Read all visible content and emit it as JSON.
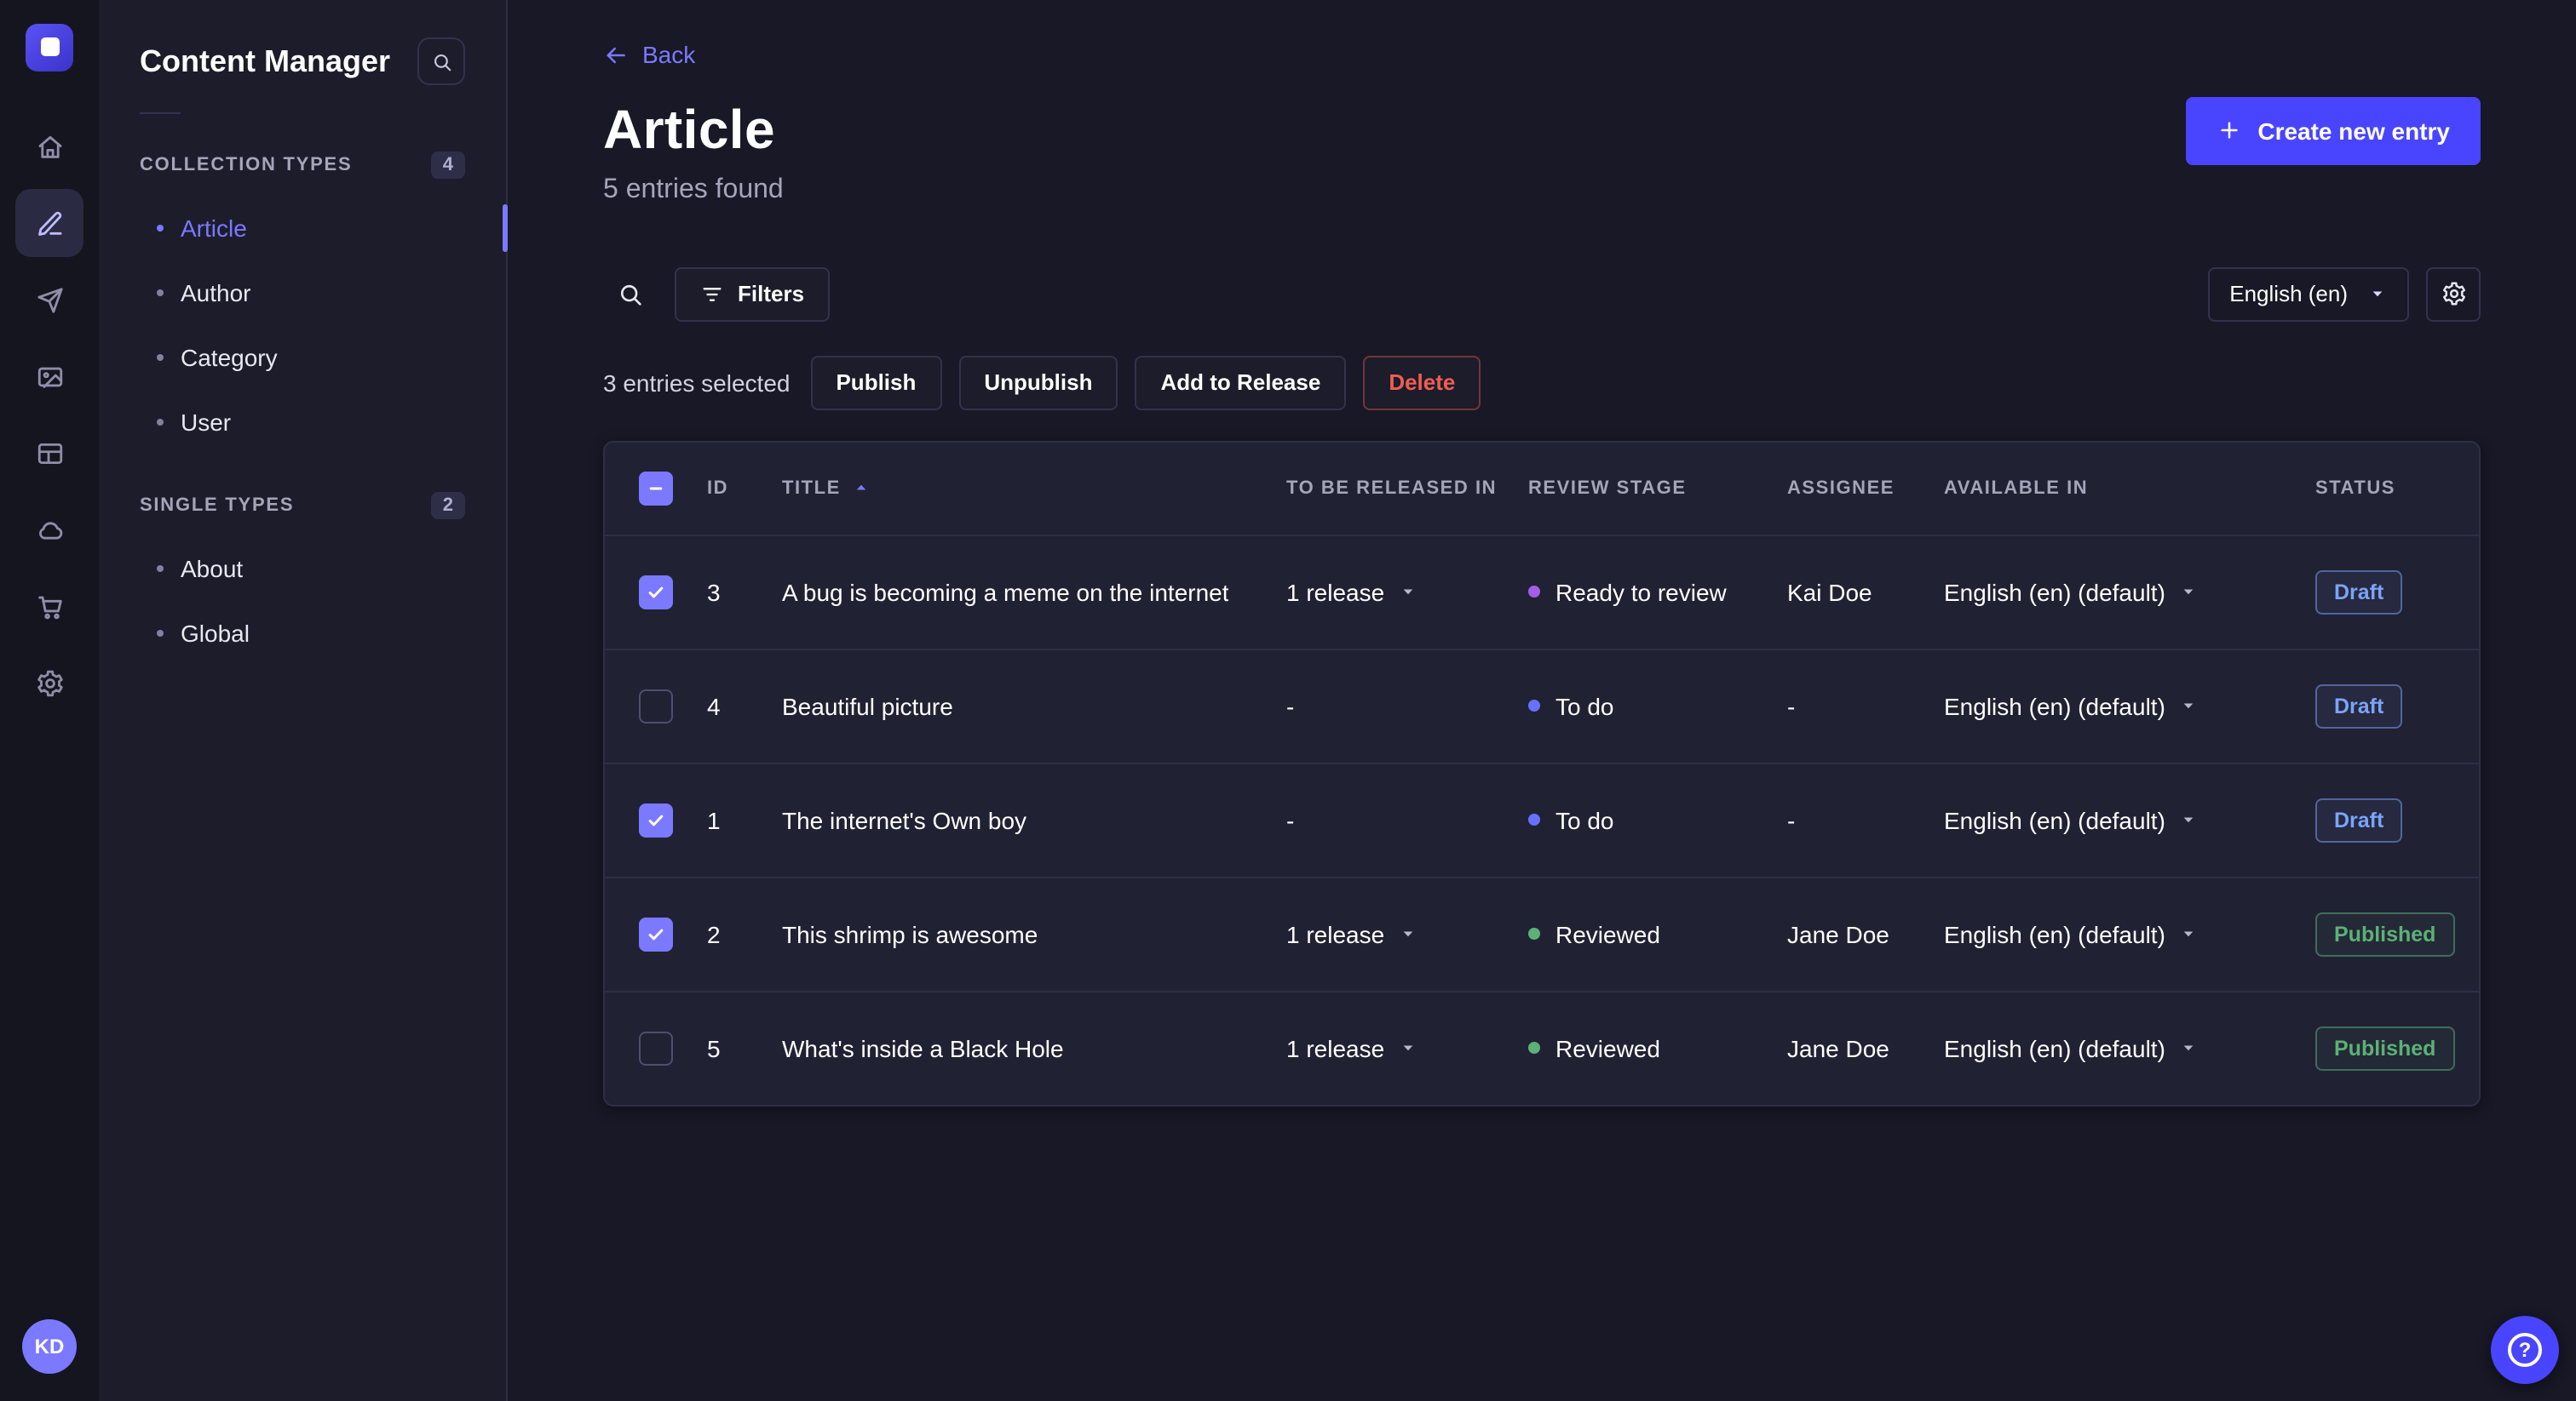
{
  "nav_rail": {
    "avatar_initials": "KD",
    "icons": [
      {
        "name": "home-icon",
        "active": false
      },
      {
        "name": "content-manager-icon",
        "active": true
      },
      {
        "name": "releases-icon",
        "active": false
      },
      {
        "name": "media-library-icon",
        "active": false
      },
      {
        "name": "content-type-builder-icon",
        "active": false
      },
      {
        "name": "cloud-icon",
        "active": false
      },
      {
        "name": "marketplace-icon",
        "active": false
      },
      {
        "name": "settings-icon",
        "active": false
      }
    ]
  },
  "sidebar": {
    "title": "Content Manager",
    "sections": [
      {
        "label": "COLLECTION TYPES",
        "badge": "4",
        "items": [
          {
            "label": "Article",
            "active": true
          },
          {
            "label": "Author",
            "active": false
          },
          {
            "label": "Category",
            "active": false
          },
          {
            "label": "User",
            "active": false
          }
        ]
      },
      {
        "label": "SINGLE TYPES",
        "badge": "2",
        "items": [
          {
            "label": "About",
            "active": false
          },
          {
            "label": "Global",
            "active": false
          }
        ]
      }
    ]
  },
  "header": {
    "back_label": "Back",
    "title": "Article",
    "subtitle": "5 entries found",
    "create_button": "Create new entry"
  },
  "toolbar": {
    "filters_label": "Filters",
    "locale_value": "English (en)"
  },
  "selection": {
    "text": "3 entries selected",
    "actions": [
      {
        "label": "Publish",
        "danger": false
      },
      {
        "label": "Unpublish",
        "danger": false
      },
      {
        "label": "Add to Release",
        "danger": false
      },
      {
        "label": "Delete",
        "danger": true
      }
    ]
  },
  "table": {
    "select_all_state": "indeterminate",
    "columns": [
      {
        "label": "ID",
        "sorted": false
      },
      {
        "label": "TITLE",
        "sorted": true
      },
      {
        "label": "TO BE RELEASED IN",
        "sorted": false
      },
      {
        "label": "REVIEW STAGE",
        "sorted": false
      },
      {
        "label": "ASSIGNEE",
        "sorted": false
      },
      {
        "label": "AVAILABLE IN",
        "sorted": false
      },
      {
        "label": "STATUS",
        "sorted": false
      }
    ],
    "rows": [
      {
        "checked": true,
        "id": "3",
        "title": "A bug is becoming a meme on the internet",
        "release": "1 release",
        "release_menu": true,
        "review_stage": "Ready to review",
        "review_color": "#a55ce8",
        "assignee": "Kai Doe",
        "available_in": "English (en) (default)",
        "status": "Draft"
      },
      {
        "checked": false,
        "id": "4",
        "title": "Beautiful picture",
        "release": "-",
        "release_menu": false,
        "review_stage": "To do",
        "review_color": "#6672ff",
        "assignee": "-",
        "available_in": "English (en) (default)",
        "status": "Draft"
      },
      {
        "checked": true,
        "id": "1",
        "title": "The internet's Own boy",
        "release": "-",
        "release_menu": false,
        "review_stage": "To do",
        "review_color": "#6672ff",
        "assignee": "-",
        "available_in": "English (en) (default)",
        "status": "Draft"
      },
      {
        "checked": true,
        "id": "2",
        "title": "This shrimp is awesome",
        "release": "1 release",
        "release_menu": true,
        "review_stage": "Reviewed",
        "review_color": "#5cb176",
        "assignee": "Jane Doe",
        "available_in": "English (en) (default)",
        "status": "Published"
      },
      {
        "checked": false,
        "id": "5",
        "title": "What's inside a Black Hole",
        "release": "1 release",
        "release_menu": true,
        "review_stage": "Reviewed",
        "review_color": "#5cb176",
        "assignee": "Jane Doe",
        "available_in": "English (en) (default)",
        "status": "Published"
      }
    ]
  },
  "help": {
    "glyph": "?"
  },
  "colors": {
    "accent": "#4945ff",
    "accent_light": "#7b79ff",
    "page_bg": "#181826",
    "rail_bg": "#15151f",
    "sidebar_bg": "#1c1c2b",
    "card_bg": "#212134",
    "border": "#2e2e45",
    "border_light": "#32324d",
    "text": "#ffffff",
    "text_soft": "#d9d8ff",
    "text_muted": "#a5a5ba",
    "danger": "#ee5e52",
    "success": "#5cb176",
    "draft": "#7ba4f8"
  }
}
